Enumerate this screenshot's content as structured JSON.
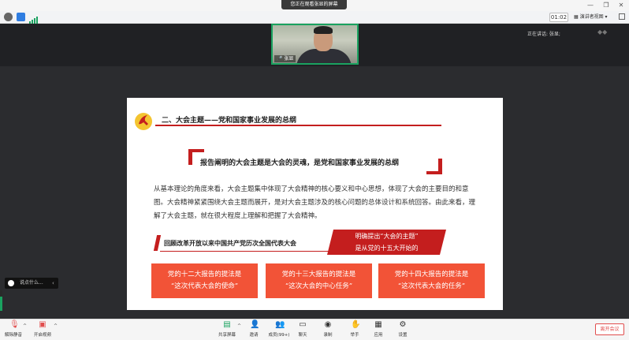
{
  "screen_share_banner": "您正在观看张显的屏幕",
  "toolbar_top": {
    "timer": "01:02",
    "view_mode": "演讲者视图"
  },
  "speaker": {
    "label": "正在讲话: 张显;",
    "video_name": "张显"
  },
  "slide": {
    "heading": "二、大会主题——党和国家事业发展的总纲",
    "quote": "报告阐明的大会主题是大会的灵魂，是党和国家事业发展的总纲",
    "body": "从基本理论的角度来看，大会主题集中体现了大会精神的核心要义和中心思想，体现了大会的主要目的和意图。大会精神紧紧围绕大会主题而展开，是对大会主题涉及的核心问题的总体设计和系统回答。由此来看，理解了大会主题，就在很大程度上理解和把握了大会精神。",
    "review_title": "回顾改革开放以来中国共产党历次全国代表大会",
    "highlight": [
      "明确提出“大会的主题”",
      "是从党的十五大开始的"
    ],
    "boxes": [
      {
        "line1": "党的十二大报告的提法是",
        "line2": "“这次代表大会的使命”"
      },
      {
        "line1": "党的十三大报告的提法是",
        "line2": "“这次大会的中心任务”"
      },
      {
        "line1": "党的十四大报告的提法是",
        "line2": "“这次代表大会的任务”"
      }
    ],
    "accent_color": "#c41e1e",
    "box_color": "#f25337"
  },
  "chat": {
    "placeholder": "说点什么..."
  },
  "mic_level": 0.7,
  "bottom_toolbar": {
    "unmute": "解除静音",
    "start_video": "开启视频",
    "share_screen": "共享屏幕",
    "invite": "邀请",
    "members": "成员(99+)",
    "barrage": "聊天",
    "record": "录制",
    "raise_hand": "举手",
    "apps": "应用",
    "settings": "设置",
    "leave": "离开会议"
  },
  "icons": [
    "info-icon",
    "shield-icon",
    "signal-icon",
    "emblem-icon",
    "mic-icon",
    "camera-icon",
    "share-icon",
    "invite-icon",
    "members-icon",
    "chat-icon",
    "record-icon",
    "hand-icon",
    "apps-icon",
    "settings-icon"
  ]
}
